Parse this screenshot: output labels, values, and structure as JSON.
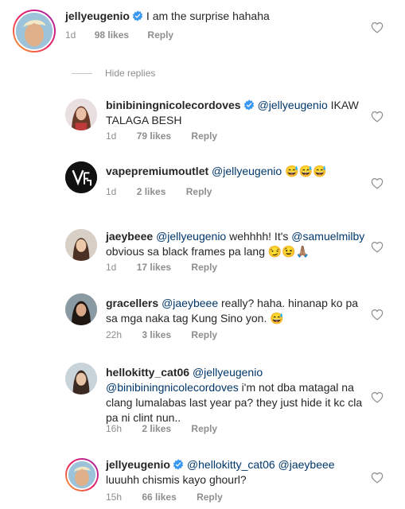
{
  "colors": {
    "mention": "#00376b",
    "meta": "#8e8e8e",
    "verified": "#3897f0"
  },
  "hide_replies_label": "Hide replies",
  "reply_label": "Reply",
  "comments": [
    {
      "username": "jellyeugenio",
      "verified": true,
      "mention": "",
      "body": "I am the surprise hahaha",
      "time": "1d",
      "likes": "98 likes"
    },
    {
      "username": "binibiningnicolecordoves",
      "verified": true,
      "mention": "@jellyeugenio",
      "body": " IKAW TALAGA BESH",
      "time": "1d",
      "likes": "79 likes"
    },
    {
      "username": "vapepremiumoutlet",
      "verified": false,
      "mention": "@jellyeugenio",
      "body": " 😅😅😅",
      "time": "1d",
      "likes": "2 likes"
    },
    {
      "username": "jaeybeee",
      "verified": false,
      "mention": "@jellyeugenio",
      "body_a": " wehhhh! It's ",
      "mention2": "@samuelmilby",
      "body_b": " obvious sa black frames pa lang 😏😉🙏🏽",
      "time": "1d",
      "likes": "17 likes"
    },
    {
      "username": "gracellers",
      "verified": false,
      "mention": "@jaeybeee",
      "body": " really? haha. hinanap ko pa sa mga naka tag Kung Sino yon. 😅",
      "time": "22h",
      "likes": "3 likes"
    },
    {
      "username": "hellokitty_cat06",
      "verified": false,
      "mention": "@jellyeugenio",
      "mention2": "@binibiningnicolecordoves",
      "body": " i'm not dba matagal na clang lumalabas last year pa? they just hide it kc cla pa ni clint nun..",
      "time": "16h",
      "likes": "2 likes"
    },
    {
      "username": "jellyeugenio",
      "verified": true,
      "mention": "@hellokitty_cat06",
      "mention2": "@jaeybeee",
      "body": " luuuhh chismis kayo ghourl?",
      "time": "15h",
      "likes": "66 likes"
    }
  ]
}
